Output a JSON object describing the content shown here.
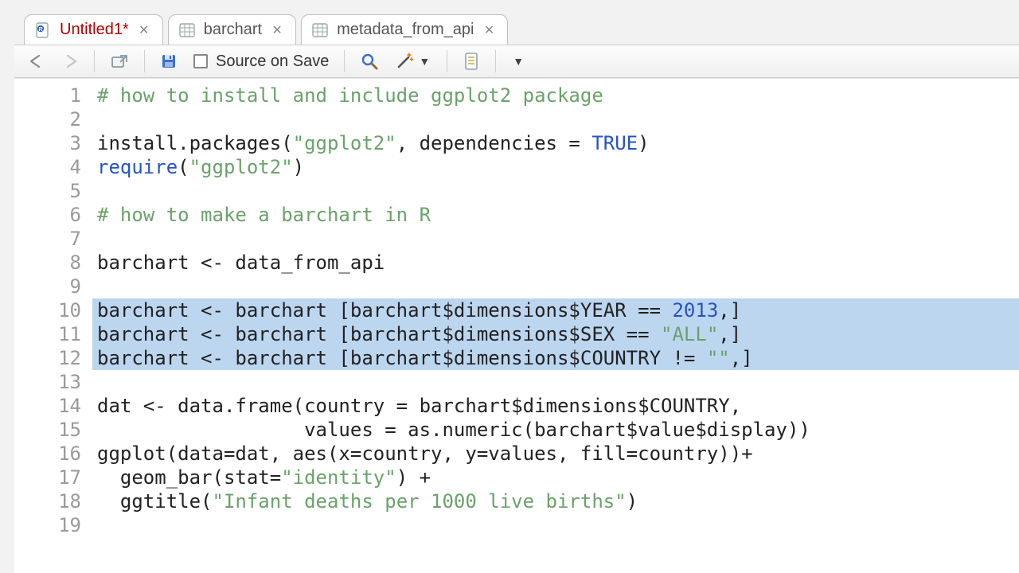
{
  "tabs": [
    {
      "label": "Untitled1*",
      "kind": "script",
      "active": true
    },
    {
      "label": "barchart",
      "kind": "data",
      "active": false
    },
    {
      "label": "metadata_from_api",
      "kind": "data",
      "active": false
    }
  ],
  "toolbar": {
    "source_on_save_label": "Source on Save"
  },
  "code": {
    "lines": [
      {
        "n": 1,
        "sel": false,
        "tokens": [
          {
            "t": "# how to install and include ggplot2 package",
            "c": "comment"
          }
        ]
      },
      {
        "n": 2,
        "sel": false,
        "tokens": [
          {
            "t": "",
            "c": ""
          }
        ]
      },
      {
        "n": 3,
        "sel": false,
        "tokens": [
          {
            "t": "install.packages(",
            "c": ""
          },
          {
            "t": "\"ggplot2\"",
            "c": "str"
          },
          {
            "t": ", dependencies = ",
            "c": ""
          },
          {
            "t": "TRUE",
            "c": "const"
          },
          {
            "t": ")",
            "c": ""
          }
        ]
      },
      {
        "n": 4,
        "sel": false,
        "tokens": [
          {
            "t": "require",
            "c": "kw"
          },
          {
            "t": "(",
            "c": ""
          },
          {
            "t": "\"ggplot2\"",
            "c": "str"
          },
          {
            "t": ")",
            "c": ""
          }
        ]
      },
      {
        "n": 5,
        "sel": false,
        "tokens": [
          {
            "t": "",
            "c": ""
          }
        ]
      },
      {
        "n": 6,
        "sel": false,
        "tokens": [
          {
            "t": "# how to make a barchart in R",
            "c": "comment"
          }
        ]
      },
      {
        "n": 7,
        "sel": false,
        "tokens": [
          {
            "t": "",
            "c": ""
          }
        ]
      },
      {
        "n": 8,
        "sel": false,
        "tokens": [
          {
            "t": "barchart <- data_from_api",
            "c": ""
          }
        ]
      },
      {
        "n": 9,
        "sel": false,
        "tokens": [
          {
            "t": "",
            "c": ""
          }
        ]
      },
      {
        "n": 10,
        "sel": true,
        "tokens": [
          {
            "t": "barchart <- barchart [barchart$dimensions$YEAR == ",
            "c": ""
          },
          {
            "t": "2013",
            "c": "num"
          },
          {
            "t": ",]",
            "c": ""
          }
        ]
      },
      {
        "n": 11,
        "sel": true,
        "tokens": [
          {
            "t": "barchart <- barchart [barchart$dimensions$SEX == ",
            "c": ""
          },
          {
            "t": "\"ALL\"",
            "c": "str"
          },
          {
            "t": ",]",
            "c": ""
          }
        ]
      },
      {
        "n": 12,
        "sel": true,
        "tokens": [
          {
            "t": "barchart <- barchart [barchart$dimensions$COUNTRY != ",
            "c": ""
          },
          {
            "t": "\"\"",
            "c": "str"
          },
          {
            "t": ",]",
            "c": ""
          }
        ]
      },
      {
        "n": 13,
        "sel": false,
        "tokens": [
          {
            "t": "",
            "c": ""
          }
        ]
      },
      {
        "n": 14,
        "sel": false,
        "tokens": [
          {
            "t": "dat <- data.frame(country = barchart$dimensions$COUNTRY,",
            "c": ""
          }
        ]
      },
      {
        "n": 15,
        "sel": false,
        "tokens": [
          {
            "t": "                  values = as.numeric(barchart$value$display))",
            "c": ""
          }
        ]
      },
      {
        "n": 16,
        "sel": false,
        "tokens": [
          {
            "t": "ggplot(data=dat, aes(x=country, y=values, fill=country))+",
            "c": ""
          }
        ]
      },
      {
        "n": 17,
        "sel": false,
        "tokens": [
          {
            "t": "  geom_bar(stat=",
            "c": ""
          },
          {
            "t": "\"identity\"",
            "c": "str"
          },
          {
            "t": ") +",
            "c": ""
          }
        ]
      },
      {
        "n": 18,
        "sel": false,
        "tokens": [
          {
            "t": "  ggtitle(",
            "c": ""
          },
          {
            "t": "\"Infant deaths per 1000 live births\"",
            "c": "str"
          },
          {
            "t": ")",
            "c": ""
          }
        ]
      },
      {
        "n": 19,
        "sel": false,
        "tokens": [
          {
            "t": "",
            "c": ""
          }
        ]
      }
    ]
  }
}
